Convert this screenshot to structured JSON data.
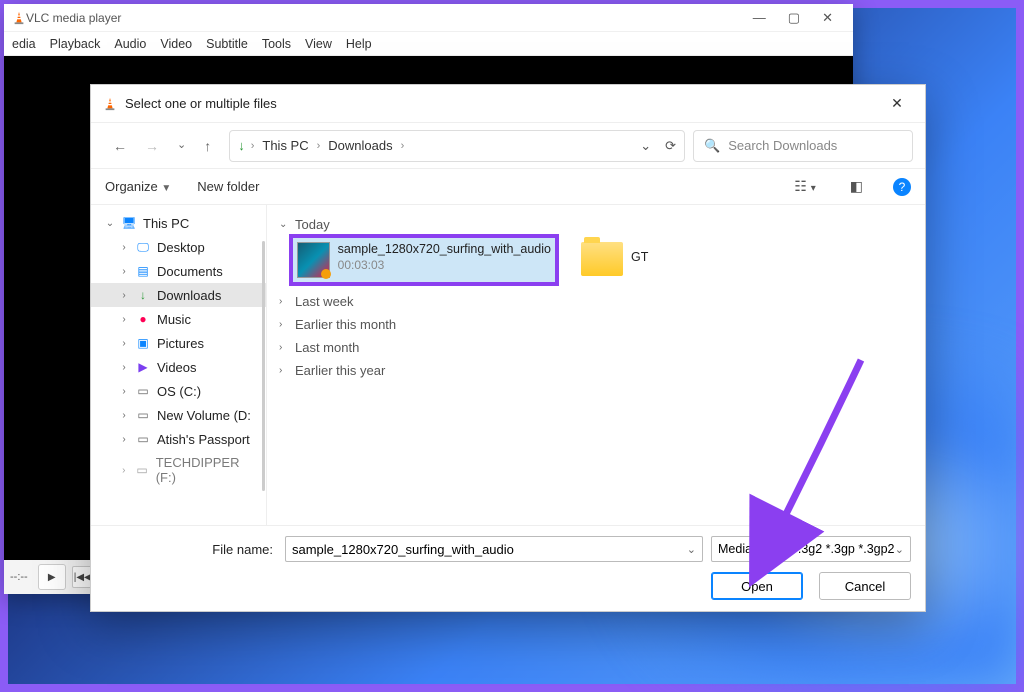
{
  "vlc": {
    "title": "VLC media player",
    "menu": [
      "edia",
      "Playback",
      "Audio",
      "Video",
      "Subtitle",
      "Tools",
      "View",
      "Help"
    ],
    "timecode": "--:--"
  },
  "dialog": {
    "title": "Select one or multiple files",
    "breadcrumb": {
      "root": "This PC",
      "folder": "Downloads"
    },
    "search_placeholder": "Search Downloads",
    "toolbar": {
      "organize": "Organize",
      "newfolder": "New folder"
    },
    "sidebar": {
      "root": "This PC",
      "items": [
        {
          "label": "Desktop",
          "icon": "icn-desk"
        },
        {
          "label": "Documents",
          "icon": "icn-doc"
        },
        {
          "label": "Downloads",
          "icon": "icn-dl",
          "selected": true
        },
        {
          "label": "Music",
          "icon": "icn-music"
        },
        {
          "label": "Pictures",
          "icon": "icn-pic"
        },
        {
          "label": "Videos",
          "icon": "icn-vid"
        },
        {
          "label": "OS (C:)",
          "icon": "icn-drv"
        },
        {
          "label": "New Volume (D:",
          "icon": "icn-drv"
        },
        {
          "label": "Atish's Passport",
          "icon": "icn-drv"
        },
        {
          "label": "TECHDIPPER (F:)",
          "icon": "icn-drv"
        }
      ]
    },
    "groups": {
      "today": "Today",
      "lastweek": "Last week",
      "earliermonth": "Earlier this month",
      "lastmonth": "Last month",
      "earlieryear": "Earlier this year"
    },
    "files": {
      "selected": {
        "name": "sample_1280x720_surfing_with_audio",
        "duration": "00:03:03"
      },
      "folder": {
        "name": "GT"
      }
    },
    "footer": {
      "filename_label": "File name:",
      "filename_value": "sample_1280x720_surfing_with_audio",
      "filter": "Media Files ( *.3g2 *.3gp *.3gp2",
      "open": "Open",
      "cancel": "Cancel"
    }
  }
}
